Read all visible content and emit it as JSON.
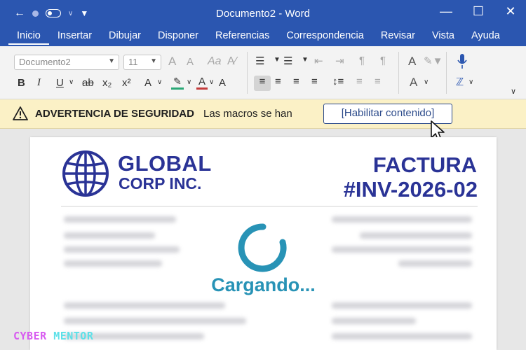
{
  "titlebar": {
    "document_title": "Documento2 - Word",
    "icons": [
      "back-arrow-icon",
      "autosave-toggle-icon",
      "customize-menu-icon",
      "minimize-icon",
      "maximize-icon",
      "close-icon"
    ]
  },
  "menu": {
    "items": [
      {
        "label": "Inicio",
        "active": true
      },
      {
        "label": "Insertar"
      },
      {
        "label": "Dibujar"
      },
      {
        "label": "Disponer"
      },
      {
        "label": "Referencias"
      },
      {
        "label": "Correspondencia"
      },
      {
        "label": "Revisar"
      },
      {
        "label": "Vista"
      },
      {
        "label": "Ayuda"
      }
    ]
  },
  "ribbon": {
    "font_name": "Documento2",
    "font_size": "11",
    "bold": "B",
    "italic": "I",
    "underline": "U",
    "strikethrough": "ab",
    "subscript": "x₂",
    "superscript": "x²",
    "font_color_a": "A",
    "clear_format": "A",
    "styles_a": "A",
    "grow_a": "A",
    "shrink_a": "A"
  },
  "security_bar": {
    "title": "ADVERTENCIA DE SEGURIDAD",
    "message": "Las macros se han",
    "button_label": "[Habilitar contenido]"
  },
  "document": {
    "company_line1": "GLOBAL",
    "company_line2": "CORP INC.",
    "invoice_line1": "FACTURA",
    "invoice_line2": "#INV-2026-02",
    "loading_text": "Cargando..."
  },
  "watermark": {
    "part1": "CYBER ",
    "part2": "MENTOR"
  },
  "colors": {
    "word_blue": "#2b56b0",
    "brand_navy": "#2a3396",
    "loading_teal": "#2893b6",
    "warning_bg": "#fbf1c6"
  }
}
